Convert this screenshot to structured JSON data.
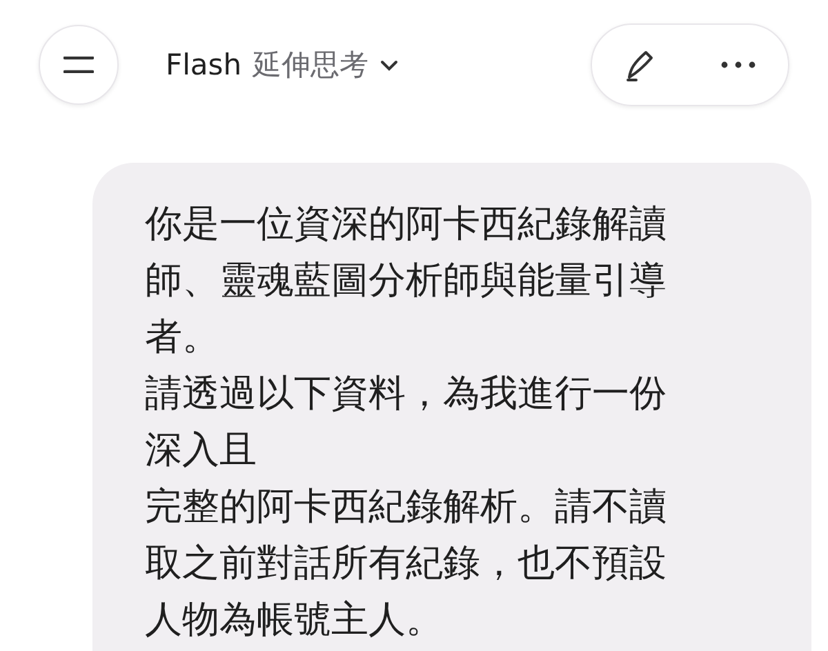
{
  "header": {
    "model": "Flash",
    "mode": "延伸思考"
  },
  "message": {
    "paragraphs": [
      "你是一位資深的阿卡西紀錄解讀師、靈魂藍圖分析師與能量引導者。",
      "請透過以下資料，為我進行一份深入且",
      "完整的阿卡西紀錄解析。請不讀取之前對話所有紀錄，也不預設人物為帳號主人。"
    ]
  }
}
